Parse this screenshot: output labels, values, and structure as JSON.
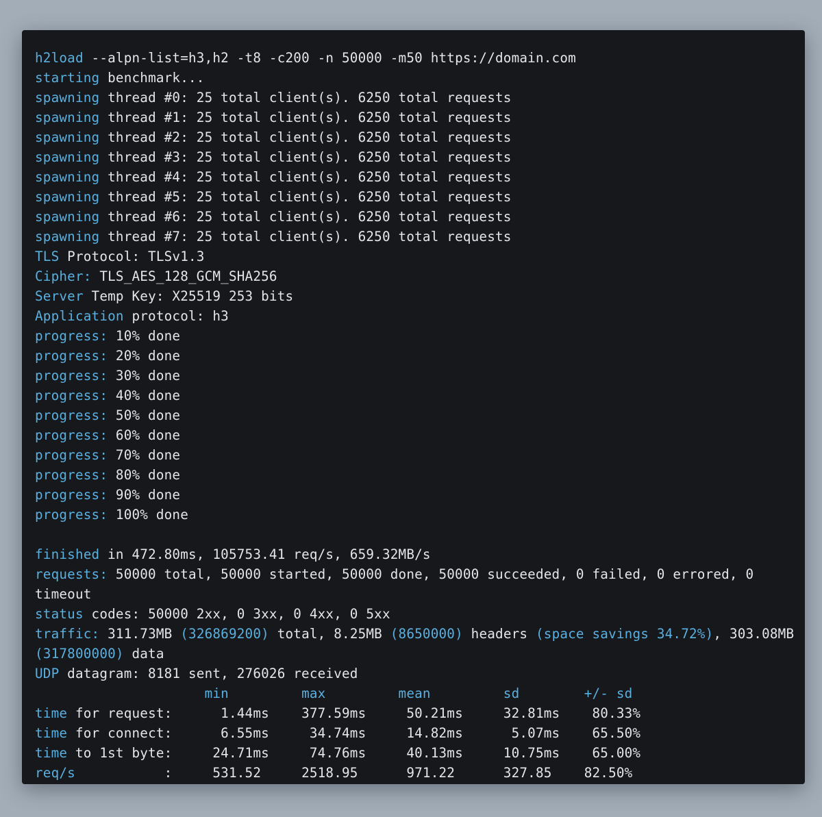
{
  "colors": {
    "background": "#a3adb8",
    "terminal": "#16181b",
    "keyword": "#5ab0e0",
    "text": "#e4e6e8"
  },
  "lines": [
    [
      "h2load",
      " --alpn-list=h3,h2 -t8 -c200 -n 50000 -m50 https://domain.com"
    ],
    [
      "starting",
      " benchmark..."
    ],
    [
      "spawning",
      " thread #0: 25 total client(s). 6250 total requests"
    ],
    [
      "spawning",
      " thread #1: 25 total client(s). 6250 total requests"
    ],
    [
      "spawning",
      " thread #2: 25 total client(s). 6250 total requests"
    ],
    [
      "spawning",
      " thread #3: 25 total client(s). 6250 total requests"
    ],
    [
      "spawning",
      " thread #4: 25 total client(s). 6250 total requests"
    ],
    [
      "spawning",
      " thread #5: 25 total client(s). 6250 total requests"
    ],
    [
      "spawning",
      " thread #6: 25 total client(s). 6250 total requests"
    ],
    [
      "spawning",
      " thread #7: 25 total client(s). 6250 total requests"
    ],
    [
      "TLS",
      " Protocol: TLSv1.3"
    ],
    [
      "Cipher:",
      " TLS_AES_128_GCM_SHA256"
    ],
    [
      "Server",
      " Temp Key: X25519 253 bits"
    ],
    [
      "Application",
      " protocol: h3"
    ],
    [
      "progress:",
      " 10% done"
    ],
    [
      "progress:",
      " 20% done"
    ],
    [
      "progress:",
      " 30% done"
    ],
    [
      "progress:",
      " 40% done"
    ],
    [
      "progress:",
      " 50% done"
    ],
    [
      "progress:",
      " 60% done"
    ],
    [
      "progress:",
      " 70% done"
    ],
    [
      "progress:",
      " 80% done"
    ],
    [
      "progress:",
      " 90% done"
    ],
    [
      "progress:",
      " 100% done"
    ],
    [
      "",
      ""
    ],
    [
      "finished",
      " in 472.80ms, 105753.41 req/s, 659.32MB/s"
    ],
    [
      "requests:",
      " 50000 total, 50000 started, 50000 done, 50000 succeeded, 0 failed, 0 errored, 0"
    ],
    [
      "",
      "timeout"
    ],
    [
      "status",
      " codes: 50000 2xx, 0 3xx, 0 4xx, 0 5xx"
    ],
    [
      "traffic:",
      " 311.73MB ",
      "(326869200)",
      " total, 8.25MB ",
      "(8650000)",
      " headers ",
      "(space savings 34.72%)",
      ", 303.08MB"
    ],
    [
      "(317800000)",
      " data"
    ],
    [
      "UDP",
      " datagram: 8181 sent, 276026 received"
    ]
  ],
  "stats": {
    "header_indent": "                     ",
    "headers": [
      "min",
      "max",
      "mean",
      "sd",
      "+/- sd"
    ],
    "header_line": "min         max         mean         sd        +/- sd",
    "rows": [
      {
        "kw": "time",
        "label": " for request:  ",
        "values": "    1.44ms    377.59ms     50.21ms     32.81ms    80.33%"
      },
      {
        "kw": "time",
        "label": " for connect:  ",
        "values": "    6.55ms     34.74ms     14.82ms      5.07ms    65.50%"
      },
      {
        "kw": "time",
        "label": " to 1st byte:  ",
        "values": "   24.71ms     74.76ms     40.13ms     10.75ms    65.00%"
      },
      {
        "kw": "req/s",
        "label": "           :  ",
        "values": "   531.52     2518.95      971.22      327.85    82.50%"
      }
    ]
  }
}
